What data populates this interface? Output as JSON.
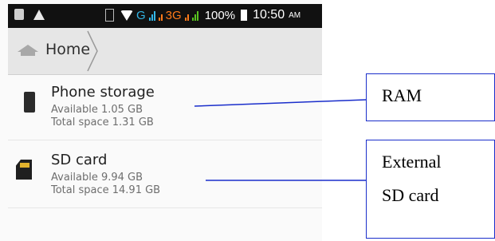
{
  "statusbar": {
    "network_g": "G",
    "network_3g": "3G",
    "battery_percent": "100%",
    "time": "10:50",
    "ampm": "AM"
  },
  "breadcrumb": {
    "label": "Home"
  },
  "storage": [
    {
      "title": "Phone storage",
      "available": "Available 1.05 GB",
      "total": "Total space 1.31 GB"
    },
    {
      "title": "SD card",
      "available": "Available 9.94 GB",
      "total": "Total space 14.91 GB"
    }
  ],
  "annotations": {
    "ram": "RAM",
    "sd_line1": "External",
    "sd_line2": "SD card"
  },
  "colors": {
    "annotation_line": "#1a2ecb",
    "header_bg": "#e6e6e6",
    "statusbar_bg": "#111111"
  },
  "icons": [
    "sim-icon",
    "warning-icon",
    "sd-status-icon",
    "wifi-icon",
    "signal-icon",
    "battery-icon",
    "home-icon",
    "chevron-right-icon",
    "phone-storage-icon",
    "sd-card-icon"
  ]
}
